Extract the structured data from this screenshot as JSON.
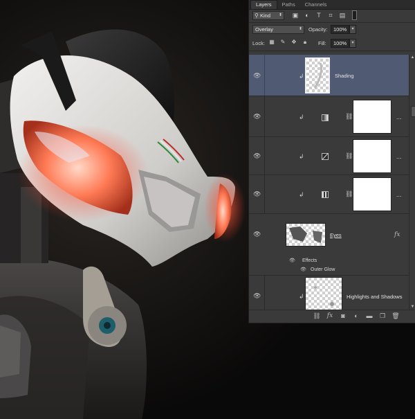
{
  "panel": {
    "tabs": [
      "Layers",
      "Paths",
      "Channels"
    ],
    "filter": {
      "label": "Kind"
    },
    "blend_mode": "Overlay",
    "opacity_label": "Opacity:",
    "opacity_value": "100%",
    "lock_label": "Lock:",
    "fill_label": "Fill:",
    "fill_value": "100%",
    "layers": [
      {
        "name": "Shading",
        "selected": true
      },
      {
        "name": "",
        "type": "gradient-map"
      },
      {
        "name": "",
        "type": "curves"
      },
      {
        "name": "",
        "type": "color-balance"
      },
      {
        "name": "Eyes",
        "effects_label": "Effects",
        "effect": "Outer Glow"
      },
      {
        "name": "Highlights and Shadows"
      }
    ],
    "menu_glyph": "...",
    "fx_glyph": "fx"
  },
  "colors": {
    "panel_bg": "#3a3a3a",
    "selected_layer": "#505a72"
  }
}
